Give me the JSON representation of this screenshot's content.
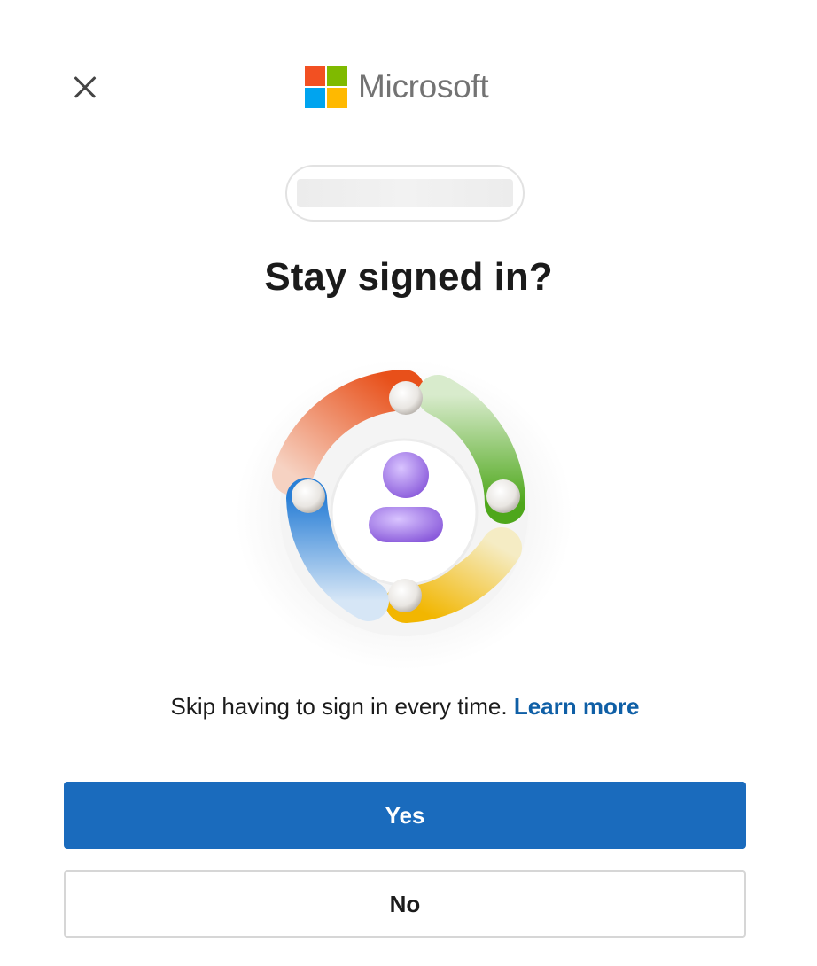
{
  "header": {
    "close_icon": "close-icon",
    "brand_name": "Microsoft",
    "brand_colors": [
      "#f25022",
      "#7fba00",
      "#00a4ef",
      "#ffb900"
    ]
  },
  "account": {
    "email": ""
  },
  "main": {
    "title": "Stay signed in?",
    "description": "Skip having to sign in every time.",
    "learn_more_label": "Learn more",
    "illustration_icon": "stay-signed-in-illustration"
  },
  "actions": {
    "yes_label": "Yes",
    "no_label": "No"
  },
  "colors": {
    "primary": "#1a6bbd",
    "link": "#0f5fa6",
    "text": "#1b1b1b"
  }
}
